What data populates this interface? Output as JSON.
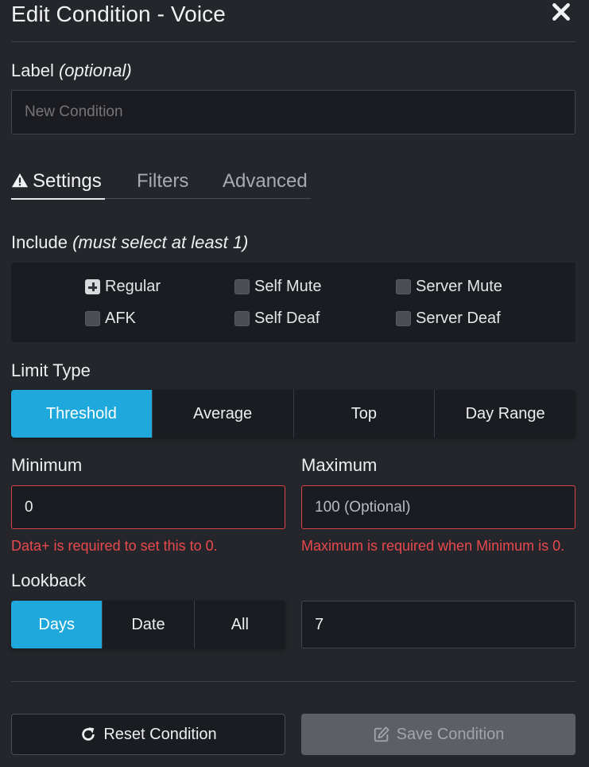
{
  "header": {
    "title": "Edit Condition - Voice",
    "close_icon": "close-icon"
  },
  "label_field": {
    "heading": "Label",
    "heading_note": "(optional)",
    "placeholder": "New Condition"
  },
  "tabs": [
    {
      "label": "Settings",
      "icon": "warning-icon",
      "active": true
    },
    {
      "label": "Filters",
      "active": false
    },
    {
      "label": "Advanced",
      "active": false
    }
  ],
  "include": {
    "heading": "Include",
    "heading_note": "(must select at least 1)",
    "options": [
      {
        "label": "Regular",
        "checked": true
      },
      {
        "label": "Self Mute",
        "checked": false
      },
      {
        "label": "Server Mute",
        "checked": false
      },
      {
        "label": "AFK",
        "checked": false
      },
      {
        "label": "Self Deaf",
        "checked": false
      },
      {
        "label": "Server Deaf",
        "checked": false
      }
    ]
  },
  "limit_type": {
    "heading": "Limit Type",
    "options": [
      "Threshold",
      "Average",
      "Top",
      "Day Range"
    ],
    "selected": "Threshold"
  },
  "minimum": {
    "heading": "Minimum",
    "value": "0",
    "error": "Data+ is required to set this to 0."
  },
  "maximum": {
    "heading": "Maximum",
    "placeholder": "100 (Optional)",
    "error": "Maximum is required when Minimum is 0."
  },
  "lookback": {
    "heading": "Lookback",
    "options": [
      "Days",
      "Date",
      "All"
    ],
    "selected": "Days",
    "value": "7"
  },
  "actions": {
    "reset_label": "Reset Condition",
    "save_label": "Save Condition"
  },
  "colors": {
    "accent": "#1fa8dc",
    "error": "#e8494f",
    "background": "#24262b",
    "field": "#1b1c21"
  }
}
